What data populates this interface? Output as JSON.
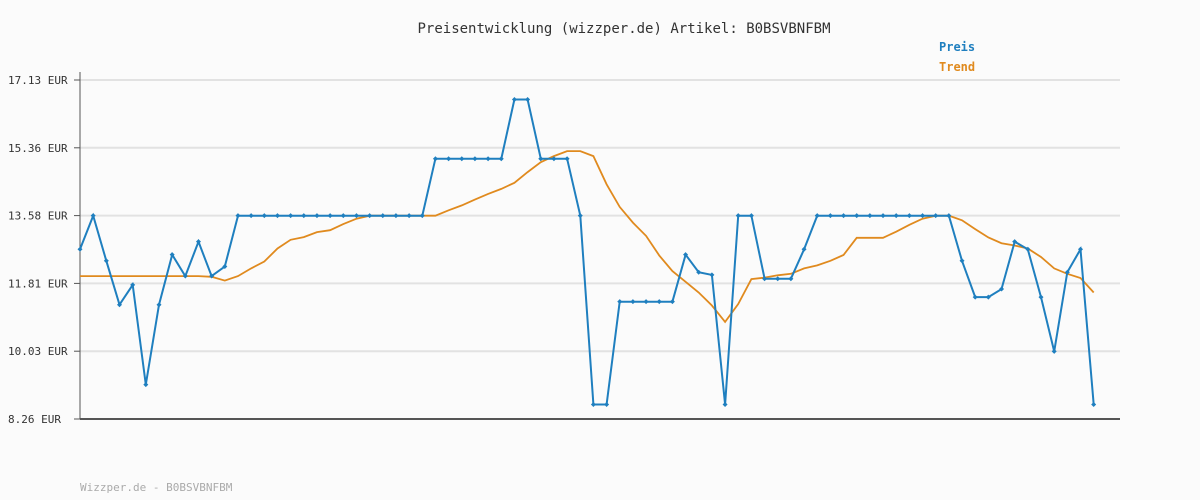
{
  "chart_data": {
    "type": "line",
    "title": "Preisentwicklung (wizzper.de) Artikel: B0BSVBNFBM",
    "footer": "Wizzper.de - B0BSVBNFBM",
    "legend_position": "top-right",
    "grid": true,
    "y_ticks": [
      "17.13 EUR",
      "15.36 EUR",
      "13.58 EUR",
      "11.81 EUR",
      "10.03 EUR",
      "8.26 EUR"
    ],
    "ylim": [
      8.26,
      17.13
    ],
    "x": [
      0,
      1,
      2,
      3,
      4,
      5,
      6,
      7,
      8,
      9,
      10,
      11,
      12,
      13,
      14,
      15,
      16,
      17,
      18,
      19,
      20,
      21,
      22,
      23,
      24,
      25,
      26,
      27,
      28,
      29,
      30,
      31,
      32,
      33,
      34,
      35,
      36,
      37,
      38,
      39,
      40,
      41,
      42,
      43,
      44,
      45,
      46,
      47,
      48,
      49,
      50,
      51,
      52,
      53,
      54,
      55,
      56,
      57,
      58,
      59,
      60,
      61,
      62,
      63,
      64,
      65,
      66,
      67,
      68,
      69,
      70,
      71,
      72,
      73,
      74,
      75,
      76,
      77,
      78,
      79
    ],
    "series": [
      {
        "name": "Preis",
        "color": "#1f7fbf",
        "values": [
          12.7,
          13.58,
          12.4,
          11.25,
          11.77,
          9.16,
          11.25,
          12.56,
          12.0,
          12.9,
          12.0,
          12.25,
          13.58,
          13.58,
          13.58,
          13.58,
          13.58,
          13.58,
          13.58,
          13.58,
          13.58,
          13.58,
          13.58,
          13.58,
          13.58,
          13.58,
          13.58,
          15.07,
          15.07,
          15.07,
          15.07,
          15.07,
          15.07,
          16.62,
          16.62,
          15.07,
          15.07,
          15.07,
          13.58,
          8.64,
          8.64,
          11.33,
          11.33,
          11.33,
          11.33,
          11.33,
          12.56,
          12.1,
          12.03,
          8.64,
          13.58,
          13.58,
          11.93,
          11.93,
          11.93,
          12.7,
          13.58,
          13.58,
          13.58,
          13.58,
          13.58,
          13.58,
          13.58,
          13.58,
          13.58,
          13.58,
          13.58,
          12.4,
          11.45,
          11.45,
          11.66,
          12.9,
          12.7,
          11.45,
          10.03,
          12.1,
          12.7,
          8.64
        ]
      },
      {
        "name": "Trend",
        "color": "#e08a1e",
        "values": [
          12.0,
          12.0,
          12.0,
          12.0,
          12.0,
          12.0,
          12.0,
          12.0,
          12.0,
          12.0,
          11.98,
          11.88,
          12.0,
          12.2,
          12.38,
          12.72,
          12.95,
          13.02,
          13.15,
          13.2,
          13.36,
          13.5,
          13.58,
          13.58,
          13.58,
          13.58,
          13.58,
          13.58,
          13.72,
          13.85,
          14.0,
          14.15,
          14.28,
          14.44,
          14.72,
          14.98,
          15.14,
          15.27,
          15.27,
          15.14,
          14.4,
          13.81,
          13.4,
          13.05,
          12.54,
          12.13,
          11.85,
          11.57,
          11.23,
          10.8,
          11.27,
          11.92,
          11.96,
          12.02,
          12.06,
          12.2,
          12.28,
          12.4,
          12.55,
          13.0,
          13.0,
          13.0,
          13.16,
          13.34,
          13.5,
          13.58,
          13.58,
          13.46,
          13.23,
          13.01,
          12.86,
          12.8,
          12.72,
          12.5,
          12.2,
          12.06,
          11.95,
          11.57
        ]
      }
    ]
  }
}
